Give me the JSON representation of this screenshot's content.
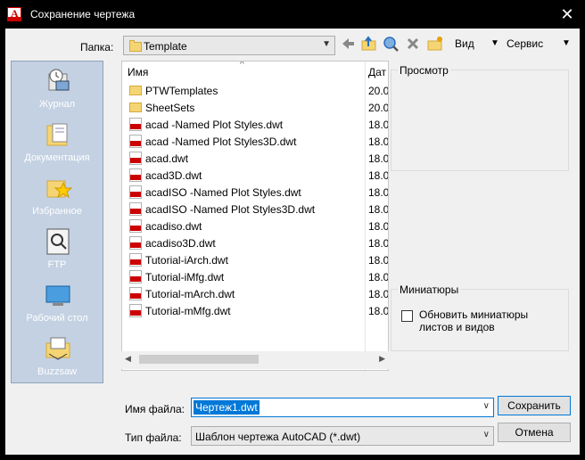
{
  "window": {
    "title": "Сохранение чертежа",
    "close_glyph": "✕"
  },
  "toolbar": {
    "folder_label": "Папка:",
    "folder_value": "Template",
    "view_label": "Вид",
    "tools_label": "Сервис"
  },
  "places": [
    {
      "label": "Журнал",
      "icon": "history-icon"
    },
    {
      "label": "Документация",
      "icon": "documents-icon"
    },
    {
      "label": "Избранное",
      "icon": "favorites-icon"
    },
    {
      "label": "FTP",
      "icon": "ftp-icon"
    },
    {
      "label": "Рабочий стол",
      "icon": "desktop-icon"
    },
    {
      "label": "Buzzsaw",
      "icon": "buzzsaw-icon"
    }
  ],
  "file_list": {
    "col_name": "Имя",
    "col_date": "Дат",
    "sort_glyph": "^",
    "items": [
      {
        "name": "PTWTemplates",
        "date": "20.0",
        "type": "folder"
      },
      {
        "name": "SheetSets",
        "date": "20.0",
        "type": "folder"
      },
      {
        "name": "acad -Named Plot Styles.dwt",
        "date": "18.0",
        "type": "dwt"
      },
      {
        "name": "acad -Named Plot Styles3D.dwt",
        "date": "18.0",
        "type": "dwt"
      },
      {
        "name": "acad.dwt",
        "date": "18.0",
        "type": "dwt"
      },
      {
        "name": "acad3D.dwt",
        "date": "18.0",
        "type": "dwt"
      },
      {
        "name": "acadISO -Named Plot Styles.dwt",
        "date": "18.0",
        "type": "dwt"
      },
      {
        "name": "acadISO -Named Plot Styles3D.dwt",
        "date": "18.0",
        "type": "dwt"
      },
      {
        "name": "acadiso.dwt",
        "date": "18.0",
        "type": "dwt"
      },
      {
        "name": "acadiso3D.dwt",
        "date": "18.0",
        "type": "dwt"
      },
      {
        "name": "Tutorial-iArch.dwt",
        "date": "18.0",
        "type": "dwt"
      },
      {
        "name": "Tutorial-iMfg.dwt",
        "date": "18.0",
        "type": "dwt"
      },
      {
        "name": "Tutorial-mArch.dwt",
        "date": "18.0",
        "type": "dwt"
      },
      {
        "name": "Tutorial-mMfg.dwt",
        "date": "18.0",
        "type": "dwt"
      }
    ]
  },
  "preview": {
    "label": "Просмотр"
  },
  "thumbnails": {
    "label": "Миниатюры",
    "checkbox_label_line1": "Обновить миниатюры",
    "checkbox_label_line2": "листов и видов",
    "checked": false
  },
  "filename": {
    "label": "Имя файла:",
    "value": "Чертеж1.dwt"
  },
  "filetype": {
    "label": "Тип файла:",
    "value": "Шаблон чертежа AutoCAD (*.dwt)"
  },
  "buttons": {
    "save": "Сохранить",
    "cancel": "Отмена"
  }
}
